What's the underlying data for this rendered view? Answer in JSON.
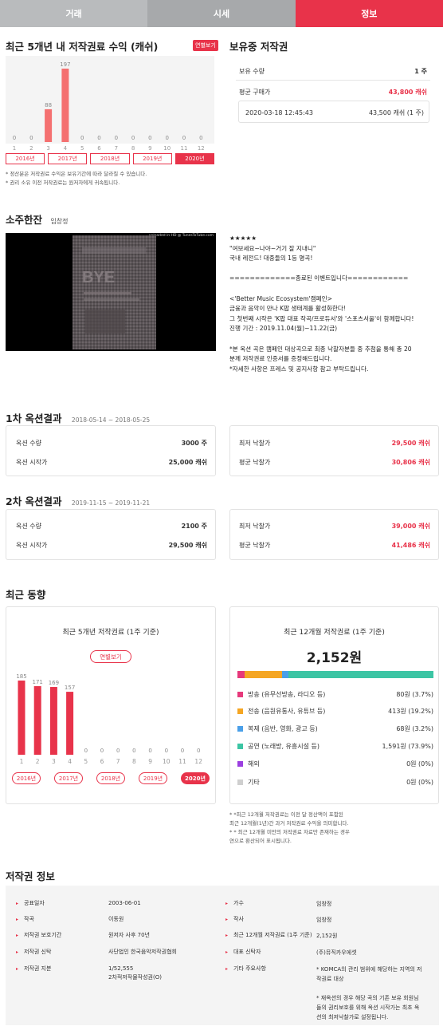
{
  "tabs": [
    {
      "label": "거래"
    },
    {
      "label": "시세"
    },
    {
      "label": "정보",
      "active": true
    }
  ],
  "revenue": {
    "title": "최근 5개년 내 저작권료 수익 (캐쉬)",
    "toggle_label": "연별보기",
    "chart_data": {
      "type": "bar",
      "categories": [
        "1",
        "2",
        "3",
        "4",
        "5",
        "6",
        "7",
        "8",
        "9",
        "10",
        "11",
        "12"
      ],
      "values": [
        0,
        0,
        88,
        197,
        0,
        0,
        0,
        0,
        0,
        0,
        0,
        0
      ],
      "ylim": [
        0,
        197
      ]
    },
    "years": [
      "2016년",
      "2017년",
      "2018년",
      "2019년",
      "2020년"
    ],
    "selected_year": "2020년",
    "notes": [
      "* 정산분은 저작권료 수익은 보유기간에 따라 달라질 수 있습니다.",
      "* 권리 소유 이전 저작권료는 원저자에게 귀속됩니다."
    ]
  },
  "holding": {
    "title": "보유중 저작권",
    "rows": [
      {
        "label": "보유 수량",
        "value": "1 주"
      },
      {
        "label": "평균 구매가",
        "value": "43,800 캐쉬"
      }
    ],
    "record": {
      "date": "2020-03-18 12:45:43",
      "value": "43,500 캐쉬 (1 주)"
    }
  },
  "song": {
    "title": "소주한잔",
    "artist": "임창정",
    "video_caption": "uploaded in HD @ TunesToTube.com",
    "description": [
      "★★★★★",
      "\"여보세요~나야~거기 잘 지내니\"",
      "국내 레전드! 대중들의 1등 명곡!",
      "",
      "=============종료된 이벤트입니다============",
      "",
      "<'Better Music Ecosystem'캠페인>",
      "금융과 음악이 만나 K팝 생태계를 활성화한다!",
      "그 첫번째 시작은 'K팝 대표 작곡/프로듀서'와 '스포츠서울'이 함께합니다!",
      "진행 기간 : 2019.11.04(월)~11.22(금)",
      "",
      "*본 옥션 곡은 캠페인 대상곡으로 최종 낙찰자분들 중 추첨을 통해 총 20",
      "분께 저작권료 인증서를 증정해드립니다.",
      "*자세한 사항은 프레스 및 공지사항 참고 부탁드립니다."
    ]
  },
  "auction1": {
    "title": "1차 옥션결과",
    "period": "2018-05-14 ~ 2018-05-25",
    "left": [
      {
        "label": "옥션 수량",
        "value": "3000 주"
      },
      {
        "label": "옥션 시작가",
        "value": "25,000 캐쉬"
      }
    ],
    "right": [
      {
        "label": "최저 낙찰가",
        "value": "29,500 캐쉬"
      },
      {
        "label": "평균 낙찰가",
        "value": "30,806 캐쉬"
      }
    ]
  },
  "auction2": {
    "title": "2차 옥션결과",
    "period": "2019-11-15 ~ 2019-11-21",
    "left": [
      {
        "label": "옥션 수량",
        "value": "2100 주"
      },
      {
        "label": "옥션 시작가",
        "value": "29,500 캐쉬"
      }
    ],
    "right": [
      {
        "label": "최저 낙찰가",
        "value": "39,000 캐쉬"
      },
      {
        "label": "평균 낙찰가",
        "value": "41,486 캐쉬"
      }
    ]
  },
  "trend": {
    "title": "최근 동향",
    "left_title": "최근 5개년 저작권료 (1주 기준)",
    "toggle_label": "연별보기",
    "chart_data": {
      "type": "bar",
      "categories": [
        "1",
        "2",
        "3",
        "4",
        "5",
        "6",
        "7",
        "8",
        "9",
        "10",
        "11",
        "12"
      ],
      "values": [
        185,
        171,
        169,
        157,
        0,
        0,
        0,
        0,
        0,
        0,
        0,
        0
      ],
      "ylim": [
        0,
        185
      ]
    },
    "years": [
      "2016년",
      "2017년",
      "2018년",
      "2019년",
      "2020년"
    ],
    "selected_year": "2020년",
    "right_title": "최근 12개월 저작권료 (1주 기준)",
    "total": "2,152원",
    "breakdown": [
      {
        "label": "방송 (유무선방송, 라디오 등)",
        "value": "80원 (3.7%)",
        "pct": 3.7,
        "color": "#e6397b"
      },
      {
        "label": "전송 (음원유통사, 유튜브 등)",
        "value": "413원 (19.2%)",
        "pct": 19.2,
        "color": "#f5a623"
      },
      {
        "label": "복제 (음반, 영화, 광고 등)",
        "value": "68원 (3.2%)",
        "pct": 3.2,
        "color": "#4a9fe8"
      },
      {
        "label": "공연 (노래방, 유흥시설 등)",
        "value": "1,591원 (73.9%)",
        "pct": 73.9,
        "color": "#3cc5a4"
      },
      {
        "label": "해외",
        "value": "0원 (0%)",
        "pct": 0,
        "color": "#9b3fe0"
      },
      {
        "label": "기타",
        "value": "0원 (0%)",
        "pct": 0,
        "color": "#cfcfcf"
      }
    ],
    "notes": [
      "* *최근 12개월 저작권료는 이전 달 정산액이 포함된",
      "최근 12개월(1년)간 과거 저작권료 수익을 의미합니다.",
      "* * 최근 12개월 미만의 저작권료 자료만 존재하는 경우",
      "연으로 환산되어 표시됩니다."
    ]
  },
  "info": {
    "title": "저작권 정보",
    "left": [
      {
        "label": "공표일자",
        "value": "2003-06-01"
      },
      {
        "label": "작곡",
        "value": "이동원"
      },
      {
        "label": "저작권 보호기간",
        "value": "원저자 사후 70년"
      },
      {
        "label": "저작권 신탁",
        "value": "사단법인 한국음악저작권협회"
      },
      {
        "label": "저작권 지분",
        "value": "1/52,555",
        "value2": "2차적저작물작성권(O)"
      }
    ],
    "right": [
      {
        "label": "가수",
        "value": "임창정"
      },
      {
        "label": "작사",
        "value": "임창정"
      },
      {
        "label": "최근 12개월 저작권료 (1주 기준)",
        "value": "2,152원"
      },
      {
        "label": "대표 신탁자",
        "value": "(주)뮤직카우에셋"
      },
      {
        "label": "기타 주요사항",
        "lines": [
          "* KOMCA의 관리 범위에 해당하는 지역의 저",
          "작권료 대상",
          "",
          "* 재옥션의 경우 해당 곡의 기존 보유 회원님",
          "들의 권리보호를 위해 옥션 시작가는 최초 옥",
          "션의 최저낙찰가로 설정됩니다."
        ]
      }
    ]
  }
}
